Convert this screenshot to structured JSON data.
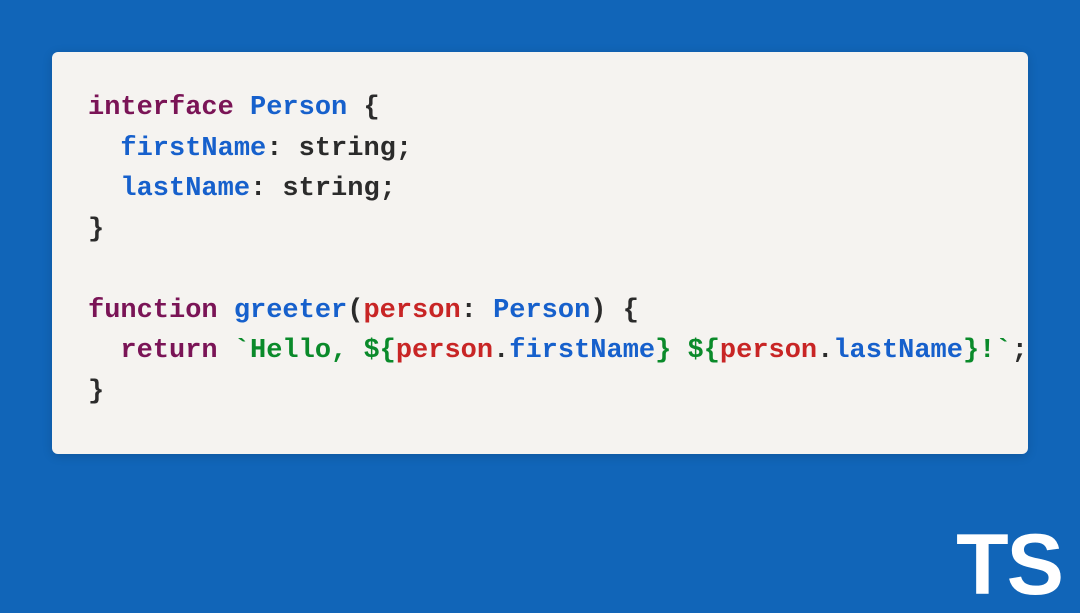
{
  "code": {
    "line1": {
      "kw": "interface",
      "type": "Person",
      "after": " {"
    },
    "line2": {
      "indent": "  ",
      "prop": "firstName",
      "rest": ": string;"
    },
    "line3": {
      "indent": "  ",
      "prop": "lastName",
      "rest": ": string;"
    },
    "line4": {
      "text": "}"
    },
    "line5": {
      "text": ""
    },
    "line6": {
      "kw": "function",
      "fn": "greeter",
      "lparen": "(",
      "param": "person",
      "colon": ": ",
      "type": "Person",
      "rparen": ") {"
    },
    "line7": {
      "indent": "  ",
      "kw": "return",
      "sp": " ",
      "bt1": "`",
      "str1": "Hello, ",
      "d1a": "$",
      "d1b": "{",
      "obj1": "person",
      "dot1": ".",
      "mem1": "firstName",
      "d1c": "}",
      "strSpace": " ",
      "d2a": "$",
      "d2b": "{",
      "obj2": "person",
      "dot2": ".",
      "mem2": "lastName",
      "d2c": "}",
      "strExcl": "!",
      "bt2": "`",
      "semi": ";"
    },
    "line8": {
      "text": "}"
    }
  },
  "logo": "TS"
}
